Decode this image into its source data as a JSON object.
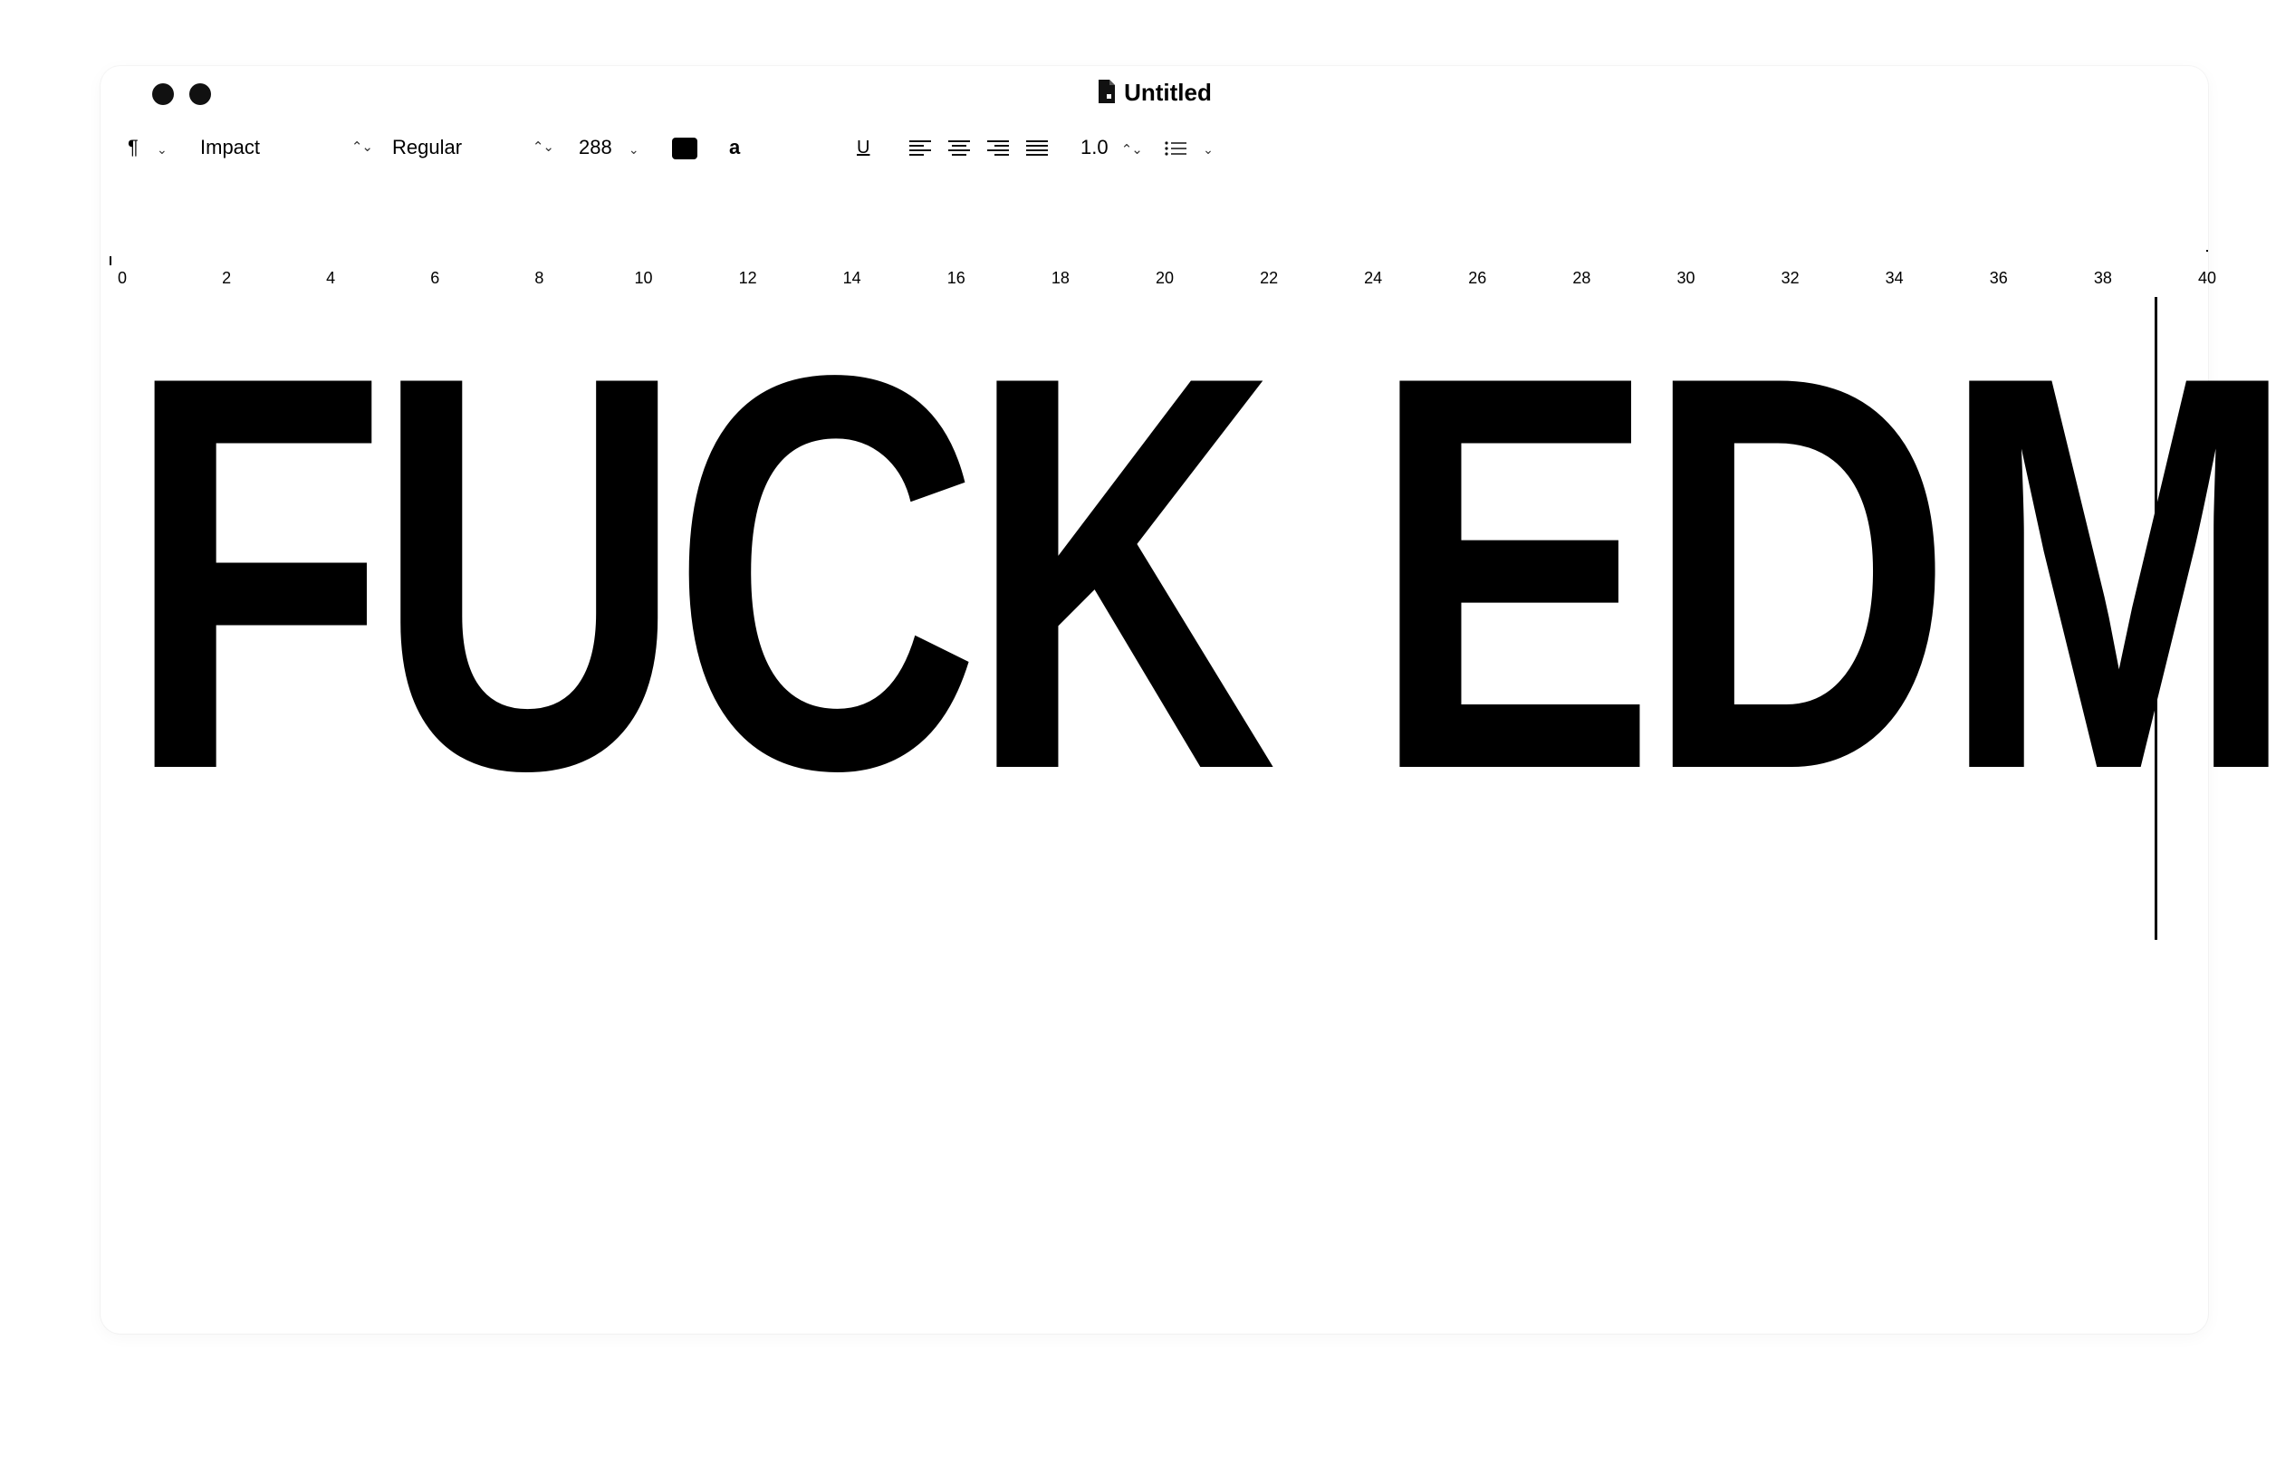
{
  "window": {
    "title": "Untitled",
    "title_icon": "document-icon"
  },
  "toolbar": {
    "paragraph_symbol": "¶",
    "font_family": "Impact",
    "font_style": "Regular",
    "font_size": "288",
    "text_color": "#000000",
    "highlight_label": "a",
    "underline_label": "U",
    "line_spacing": "1.0",
    "align_icons": [
      "align-left-icon",
      "align-center-icon",
      "align-right-icon",
      "align-justify-icon"
    ],
    "list_icon": "bullet-list-icon"
  },
  "ruler": {
    "labels": [
      "0",
      "2",
      "4",
      "6",
      "8",
      "10",
      "12",
      "14",
      "16",
      "18",
      "20",
      "22",
      "24",
      "26",
      "28",
      "30",
      "32",
      "34",
      "36",
      "38",
      "40"
    ]
  },
  "document": {
    "text": "FUCK EDM"
  }
}
